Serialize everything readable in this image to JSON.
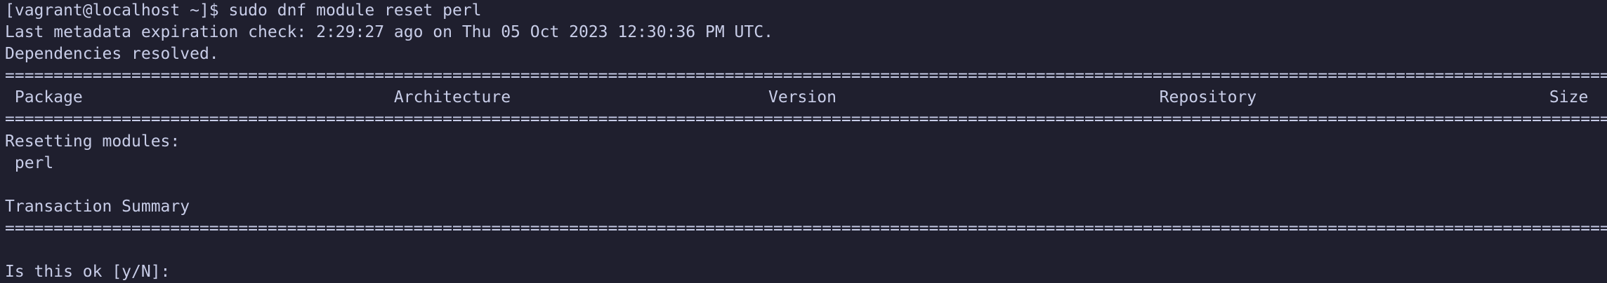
{
  "terminal": {
    "command_line": "[vagrant@localhost ~]$ sudo dnf module reset perl",
    "metadata_line": "Last metadata expiration check: 2:29:27 ago on Thu 05 Oct 2023 12:30:36 PM UTC.",
    "deps_line": "Dependencies resolved.",
    "separator": "=====================================================================================================================================================================================",
    "table_headers": [
      "Package",
      "Architecture",
      "Version",
      "Repository",
      "Size"
    ],
    "section_title": "Resetting modules:",
    "module_name": "perl",
    "summary_title": "Transaction Summary",
    "prompt": "Is this ok [y/N]: "
  },
  "colors": {
    "background": "#1f1f2e",
    "foreground": "#c8cde8"
  }
}
